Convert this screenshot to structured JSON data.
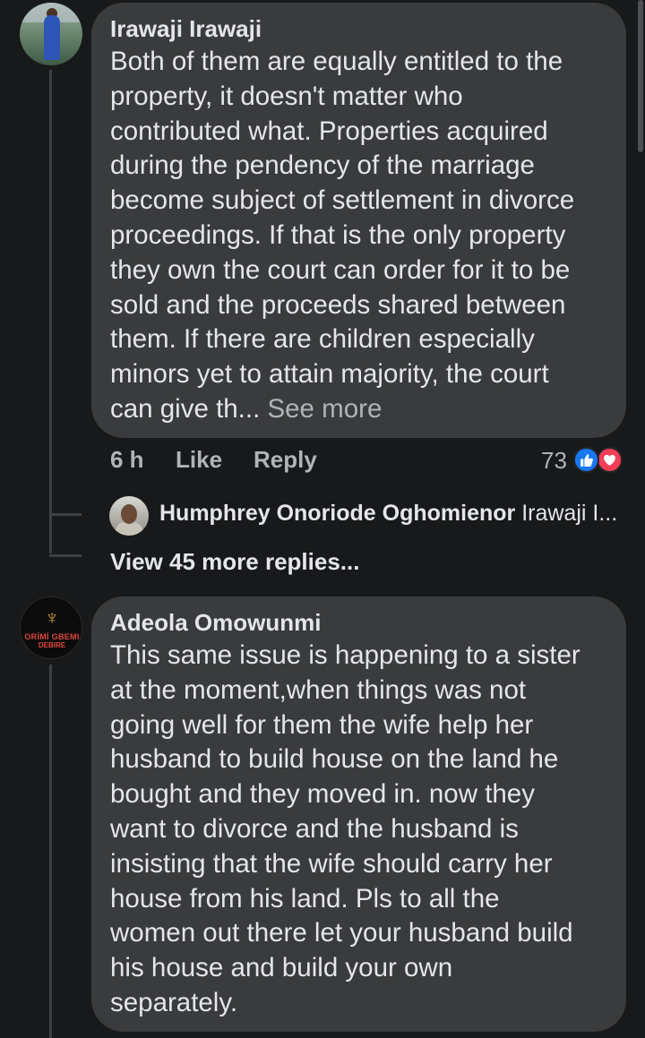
{
  "comment1": {
    "author": "Irawaji Irawaji",
    "lines": [
      "Both of them are equally entitled to the",
      "property, it doesn't matter who",
      "contributed what. Properties acquired",
      "during the pendency of the marriage",
      "become subject of settlement in divorce",
      "proceedings. If that is the only property",
      "they own the court can order for it to be",
      "sold and the proceeds shared between",
      "them. If there are children especially",
      "minors  yet to attain majority, the court"
    ],
    "last_line": "can give th...",
    "see_more": "See more",
    "time": "6 h",
    "like_label": "Like",
    "reply_label": "Reply",
    "reaction_count": "73",
    "reaction_icons": [
      "like-icon",
      "love-icon"
    ]
  },
  "reply_preview": {
    "name": "Humphrey Onoriode Oghomienor",
    "preview": "Irawaji I..."
  },
  "view_more_replies": "View 45 more replies...",
  "comment2": {
    "author": "Adeola Omowunmi",
    "avatar_text_1": "ORÍMÍ GBEMI",
    "avatar_text_2": "DEBIRE",
    "lines": [
      "This same issue is happening to a sister",
      "at the moment,when things was not",
      "going well for them the wife help her",
      "husband to build house on the land he",
      "bought and they moved in.  now they",
      "want to divorce and the husband is",
      "insisting that the wife should carry her",
      "house from his land. Pls to all the",
      "women out there let your husband build",
      "his house and build your own",
      "separately."
    ]
  },
  "colors": {
    "background": "#18191a",
    "bubble": "#3a3b3c",
    "text": "#e4e6eb",
    "muted": "#b0b3b8",
    "like_blue": "#1877f2",
    "love_red": "#f33e58"
  }
}
